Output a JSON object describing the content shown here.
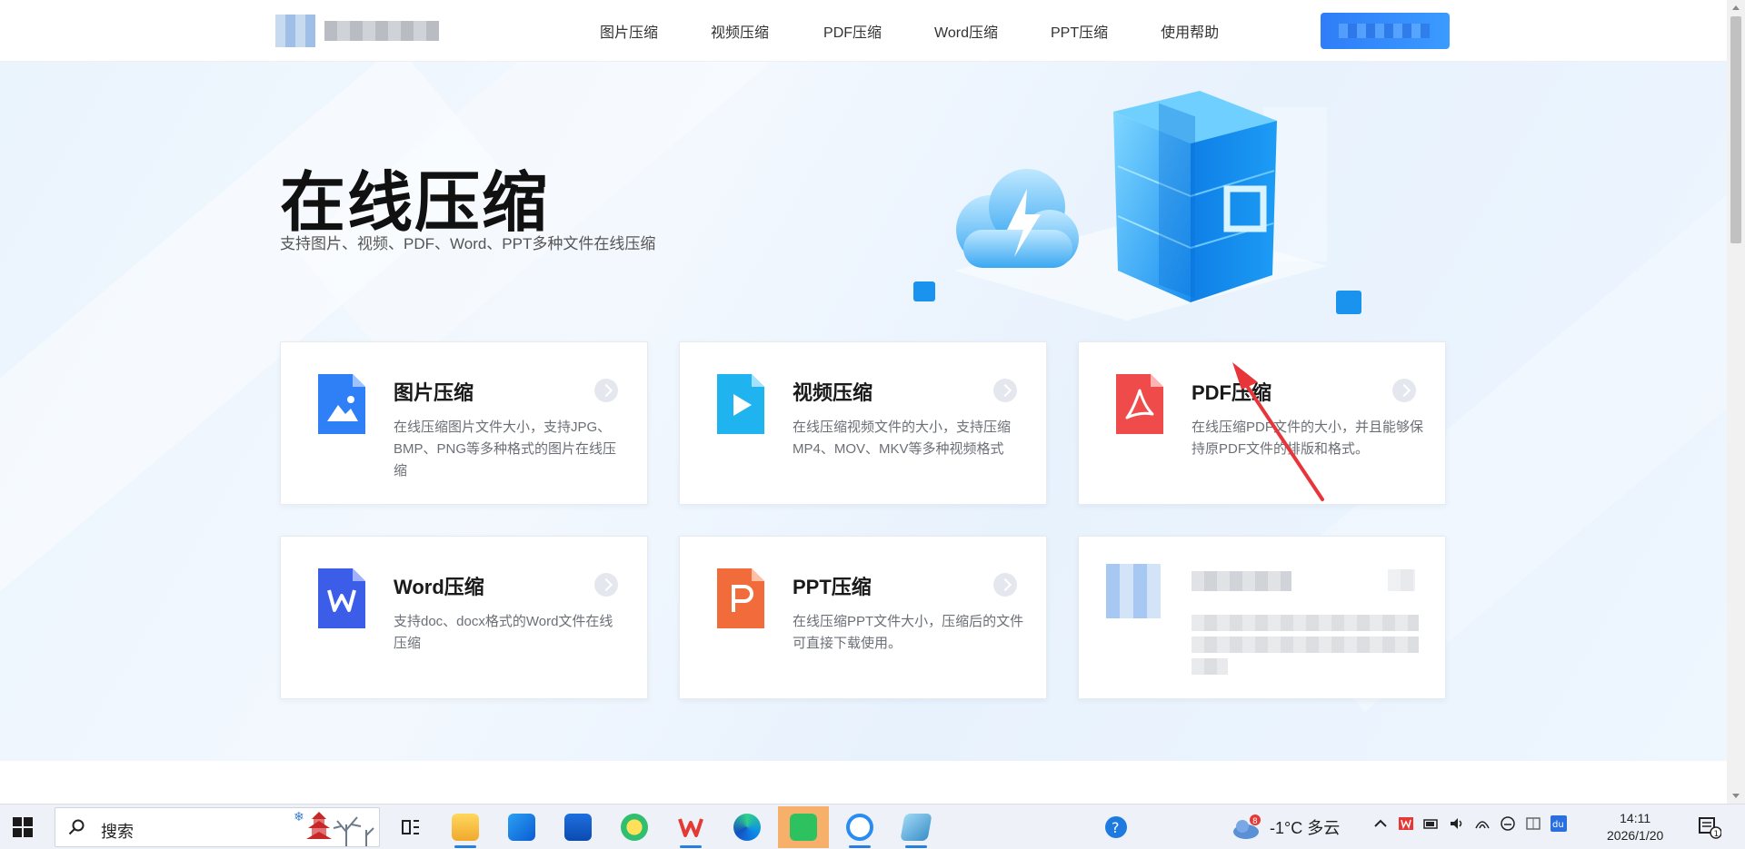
{
  "header": {
    "nav": [
      "图片压缩",
      "视频压缩",
      "PDF压缩",
      "Word压缩",
      "PPT压缩",
      "使用帮助"
    ]
  },
  "hero": {
    "title": "在线压缩",
    "subtitle": "支持图片、视频、PDF、Word、PPT多种文件在线压缩"
  },
  "cards": [
    {
      "title": "图片压缩",
      "desc": "在线压缩图片文件大小，支持JPG、BMP、PNG等多种格式的图片在线压缩",
      "icon": "image-file-icon",
      "color": "#2f80f6"
    },
    {
      "title": "视频压缩",
      "desc": "在线压缩视频文件的大小，支持压缩MP4、MOV、MKV等多种视频格式",
      "icon": "video-file-icon",
      "color": "#1fb3f0"
    },
    {
      "title": "PDF压缩",
      "desc": "在线压缩PDF文件的大小，并且能够保持原PDF文件的排版和格式。",
      "icon": "pdf-file-icon",
      "color": "#ef4b4b"
    },
    {
      "title": "Word压缩",
      "desc": "支持doc、docx格式的Word文件在线压缩",
      "icon": "word-file-icon",
      "color": "#3b5de7"
    },
    {
      "title": "PPT压缩",
      "desc": "在线压缩PPT文件大小，压缩后的文件可直接下载使用。",
      "icon": "ppt-file-icon",
      "color": "#f26b3a"
    }
  ],
  "taskbar": {
    "search_placeholder": "搜索",
    "weather_badge": "8",
    "weather": "-1°C  多云",
    "time": "14:11",
    "date": "2026/1/20",
    "tray_badge": "1"
  },
  "colors": {
    "accent": "#2f7df7",
    "annotation": "#e8353a"
  }
}
